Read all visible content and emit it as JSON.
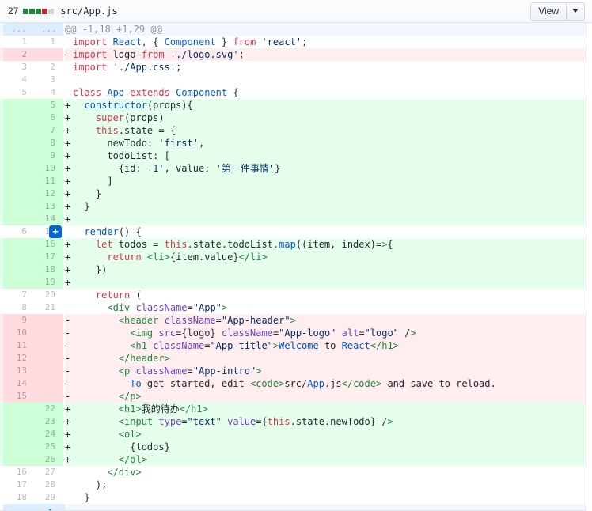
{
  "file_header": {
    "changes_count": "27",
    "diffstat_squares": [
      "add",
      "add",
      "add",
      "del",
      "neu"
    ],
    "file_path": "src/App.js",
    "view_button_label": "View",
    "caret_icon": "chevron-down-icon"
  },
  "colors": {
    "add_bg": "#e6ffed",
    "add_gutter_bg": "#cdffd8",
    "del_bg": "#ffeef0",
    "del_gutter_bg": "#ffdce0",
    "hunk_bg": "#f1f8ff",
    "hunk_gutter_bg": "#dbedff",
    "accent_blue": "#0366d6",
    "keyword_red": "#d73a49",
    "string_blue": "#032f62",
    "tag_green": "#22863a",
    "entity_purple": "#6f42c1"
  },
  "diff": {
    "hunk_header": "@@ -1,18 +1,29 @@",
    "hunk_gutter_label": "...",
    "add_comment_button": "+",
    "rows": [
      {
        "type": "hunk",
        "old": "...",
        "new": "...",
        "marker": "",
        "code": "@@ -1,18 +1,29 @@"
      },
      {
        "type": "ctx",
        "old": "1",
        "new": "1",
        "marker": " ",
        "code": "import React, { Component } from 'react';"
      },
      {
        "type": "del",
        "old": "2",
        "new": "",
        "marker": "-",
        "code": "import logo from './logo.svg';"
      },
      {
        "type": "ctx",
        "old": "3",
        "new": "2",
        "marker": " ",
        "code": "import './App.css';"
      },
      {
        "type": "ctx",
        "old": "4",
        "new": "3",
        "marker": " ",
        "code": ""
      },
      {
        "type": "ctx",
        "old": "5",
        "new": "4",
        "marker": " ",
        "code": "class App extends Component {"
      },
      {
        "type": "add",
        "old": "",
        "new": "5",
        "marker": "+",
        "code": "  constructor(props){"
      },
      {
        "type": "add",
        "old": "",
        "new": "6",
        "marker": "+",
        "code": "    super(props)"
      },
      {
        "type": "add",
        "old": "",
        "new": "7",
        "marker": "+",
        "code": "    this.state = {"
      },
      {
        "type": "add",
        "old": "",
        "new": "8",
        "marker": "+",
        "code": "      newTodo: 'first',"
      },
      {
        "type": "add",
        "old": "",
        "new": "9",
        "marker": "+",
        "code": "      todoList: ["
      },
      {
        "type": "add",
        "old": "",
        "new": "10",
        "marker": "+",
        "code": "        {id: '1', value: '第一件事情'}"
      },
      {
        "type": "add",
        "old": "",
        "new": "11",
        "marker": "+",
        "code": "      ]"
      },
      {
        "type": "add",
        "old": "",
        "new": "12",
        "marker": "+",
        "code": "    }"
      },
      {
        "type": "add",
        "old": "",
        "new": "13",
        "marker": "+",
        "code": "  }"
      },
      {
        "type": "add",
        "old": "",
        "new": "14",
        "marker": "+",
        "code": ""
      },
      {
        "type": "ctx",
        "old": "6",
        "new": "15",
        "marker": " ",
        "code": "  render() {",
        "has_button": true
      },
      {
        "type": "add",
        "old": "",
        "new": "16",
        "marker": "+",
        "code": "    let todos = this.state.todoList.map((item, index)=>{"
      },
      {
        "type": "add",
        "old": "",
        "new": "17",
        "marker": "+",
        "code": "      return <li>{item.value}</li>"
      },
      {
        "type": "add",
        "old": "",
        "new": "18",
        "marker": "+",
        "code": "    })"
      },
      {
        "type": "add",
        "old": "",
        "new": "19",
        "marker": "+",
        "code": ""
      },
      {
        "type": "ctx",
        "old": "7",
        "new": "20",
        "marker": " ",
        "code": "    return ("
      },
      {
        "type": "ctx",
        "old": "8",
        "new": "21",
        "marker": " ",
        "code": "      <div className=\"App\">"
      },
      {
        "type": "del",
        "old": "9",
        "new": "",
        "marker": "-",
        "code": "        <header className=\"App-header\">"
      },
      {
        "type": "del",
        "old": "10",
        "new": "",
        "marker": "-",
        "code": "          <img src={logo} className=\"App-logo\" alt=\"logo\" />"
      },
      {
        "type": "del",
        "old": "11",
        "new": "",
        "marker": "-",
        "code": "          <h1 className=\"App-title\">Welcome to React</h1>"
      },
      {
        "type": "del",
        "old": "12",
        "new": "",
        "marker": "-",
        "code": "        </header>"
      },
      {
        "type": "del",
        "old": "13",
        "new": "",
        "marker": "-",
        "code": "        <p className=\"App-intro\">"
      },
      {
        "type": "del",
        "old": "14",
        "new": "",
        "marker": "-",
        "code": "          To get started, edit <code>src/App.js</code> and save to reload."
      },
      {
        "type": "del",
        "old": "15",
        "new": "",
        "marker": "-",
        "code": "        </p>"
      },
      {
        "type": "add",
        "old": "",
        "new": "22",
        "marker": "+",
        "code": "        <h1>我的待办</h1>"
      },
      {
        "type": "add",
        "old": "",
        "new": "23",
        "marker": "+",
        "code": "        <input type=\"text\" value={this.state.newTodo} />"
      },
      {
        "type": "add",
        "old": "",
        "new": "24",
        "marker": "+",
        "code": "        <ol>"
      },
      {
        "type": "add",
        "old": "",
        "new": "25",
        "marker": "+",
        "code": "          {todos}"
      },
      {
        "type": "add",
        "old": "",
        "new": "26",
        "marker": "+",
        "code": "        </ol>"
      },
      {
        "type": "ctx",
        "old": "16",
        "new": "27",
        "marker": " ",
        "code": "      </div>"
      },
      {
        "type": "ctx",
        "old": "17",
        "new": "28",
        "marker": " ",
        "code": "    );"
      },
      {
        "type": "ctx",
        "old": "18",
        "new": "29",
        "marker": " ",
        "code": "  }"
      },
      {
        "type": "expander",
        "old": "",
        "new": "",
        "marker": "",
        "code": ""
      }
    ]
  }
}
